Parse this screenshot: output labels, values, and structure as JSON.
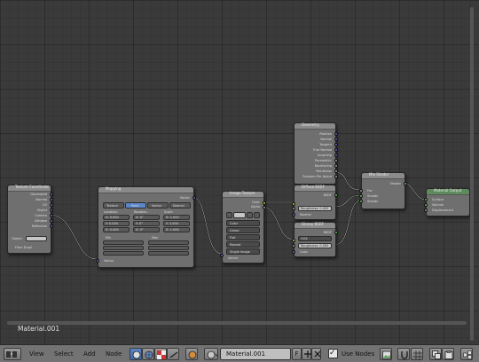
{
  "canvas": {
    "active_material": "Material.001"
  },
  "nodes": {
    "texcoord": {
      "title": "Texture Coordinate",
      "outputs": [
        "Generated",
        "Normal",
        "UV",
        "Object",
        "Camera",
        "Window",
        "Reflection"
      ],
      "object_label": "Object:",
      "dupli": "From Dupli"
    },
    "mapping": {
      "title": "Mapping",
      "vector_out": "Vector",
      "modes": [
        "Texture",
        "Point",
        "Vector",
        "Normal"
      ],
      "headers": [
        "Location:",
        "Rotation:",
        "Scale:"
      ],
      "location": [
        "X: 0.000",
        "Y: 0.000",
        "Z: 0.000"
      ],
      "rotation": [
        "X: 0°",
        "Y: 0°",
        "Z: 0°"
      ],
      "scale": [
        "X: 1.000",
        "Y: 1.000",
        "Z: 1.000"
      ],
      "min": "Min",
      "max": "Max",
      "vector_in": "Vector"
    },
    "image": {
      "title": "Image Texture",
      "outputs": [
        "Color",
        "Alpha"
      ],
      "color": "Color",
      "linear": "Linear",
      "flat": "Flat",
      "repeat": "Repeat",
      "projection": "Single Image",
      "vector_in": "Vector"
    },
    "geometry": {
      "title": "Geometry",
      "outputs": [
        "Position",
        "Normal",
        "Tangent",
        "True Normal",
        "Incoming",
        "Parametric",
        "Backfacing",
        "Pointiness",
        "Random Per Island"
      ]
    },
    "diffuse": {
      "title": "Diffuse BSDF",
      "bsdf_out": "BSDF",
      "roughness": "Roughness: 0.000",
      "inputs": [
        "Color",
        "Normal"
      ]
    },
    "glossy": {
      "title": "Glossy BSDF",
      "bsdf_out": "BSDF",
      "distribution": "GGX",
      "roughness": "Roughness: 0.000",
      "inputs": [
        "Color",
        "Normal"
      ]
    },
    "mix": {
      "title": "Mix Shader",
      "shader_out": "Shader",
      "inputs": [
        "Fac",
        "Shader",
        "Shader"
      ]
    },
    "output": {
      "title": "Material Output",
      "inputs": [
        "Surface",
        "Volume",
        "Displacement"
      ]
    }
  },
  "header": {
    "menus": [
      "View",
      "Select",
      "Add",
      "Node"
    ],
    "material_name": "Material.001",
    "fake_user": "F",
    "use_nodes": "Use Nodes"
  },
  "colors": {
    "socket_color": "#c7c729",
    "socket_float": "#a1a1a1",
    "socket_vector": "#6363c7",
    "socket_shader": "#63c763",
    "active_tab": "#5a87c9"
  }
}
